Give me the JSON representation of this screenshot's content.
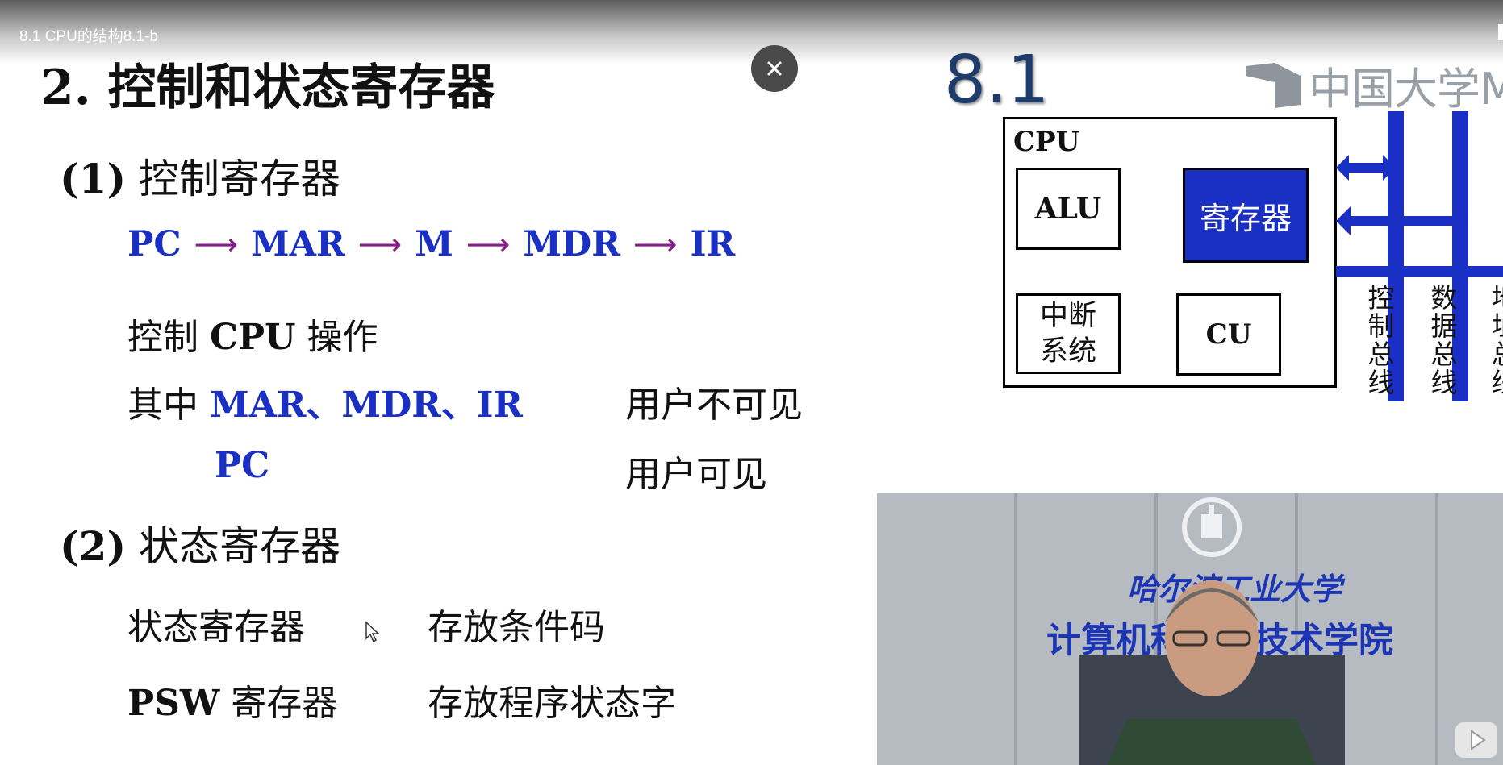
{
  "player": {
    "title": "8.1 CPU的结构8.1-b"
  },
  "slide": {
    "heading": "2.  控制和状态寄存器",
    "section1": {
      "num": "(1)",
      "label": "控制寄存器"
    },
    "flow": [
      "PC",
      "MAR",
      "M",
      "MDR",
      "IR"
    ],
    "control_line": {
      "pre": "控制 ",
      "bold": "CPU",
      "post": " 操作"
    },
    "among_prefix": "其中 ",
    "among_regs": "MAR、MDR、IR",
    "invisible": "用户不可见",
    "pc": "PC",
    "visible": "用户可见",
    "section2": {
      "num": "(2)",
      "label": "状态寄存器"
    },
    "status_reg": "状态寄存器",
    "status_desc": "存放条件码",
    "psw_bold": "PSW",
    "psw_rest": " 寄存器",
    "psw_desc": "存放程序状态字"
  },
  "diagram": {
    "number": "8.1",
    "logo_text": "中国大学MO",
    "cpu": "CPU",
    "alu": "ALU",
    "reg": "寄存器",
    "int_line1": "中断",
    "int_line2": "系统",
    "cu": "CU",
    "bus_control": "控制总线",
    "bus_data": "数据总线",
    "bus_addr": "地址总线"
  },
  "video": {
    "univ": "哈尔滨工业大学",
    "school": "计算机科学与技术学院"
  },
  "colors": {
    "accent_blue": "#1a2fc4",
    "arrow_purple": "#8a1a8a"
  }
}
